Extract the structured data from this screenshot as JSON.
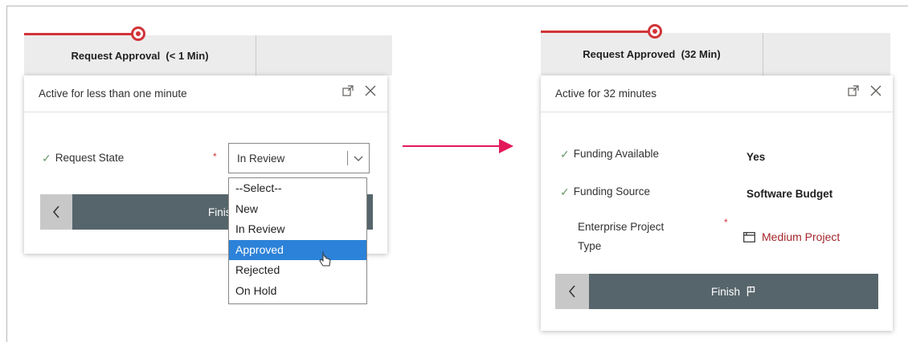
{
  "left_panel": {
    "tab_label": "Request Approval  (< 1 Min)",
    "header_text": "Active for less than one minute",
    "field": {
      "check": "✓",
      "label": "Request State",
      "required": "*",
      "value": "In Review"
    },
    "finish_label": "Finish",
    "dropdown_options": [
      "--Select--",
      "New",
      "In Review",
      "Approved",
      "Rejected",
      "On Hold"
    ],
    "highlighted_option": "Approved"
  },
  "right_panel": {
    "tab_label": "Request Approved  (32 Min)",
    "header_text": "Active for 32 minutes",
    "fields": [
      {
        "check": "✓",
        "label": "Funding Available",
        "value": "Yes"
      },
      {
        "check": "✓",
        "label": "Funding Source",
        "value": "Software Budget"
      },
      {
        "label_line1": "Enterprise Project",
        "label_line2": "Type",
        "required": "*",
        "value": "Medium Project"
      }
    ],
    "finish_label": "Finish"
  },
  "colors": {
    "stage_accent": "#d13438",
    "arrow": "#e3195a",
    "finish_bar": "#56656b",
    "selected_option": "#2c82d8",
    "lookup_link": "#a4262c"
  },
  "icons": [
    "pop-out-icon",
    "close-icon",
    "chevron-down-icon",
    "chevron-left-icon",
    "flag-icon",
    "record-icon",
    "mouse-pointer-icon"
  ]
}
